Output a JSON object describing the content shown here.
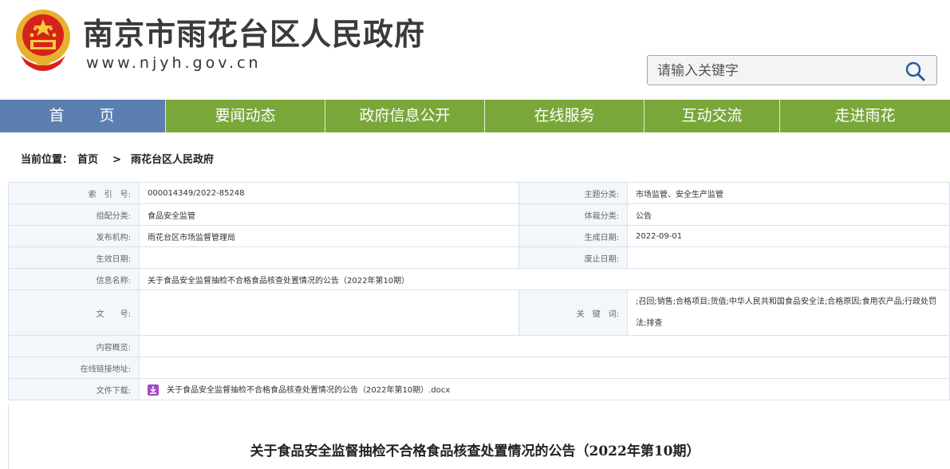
{
  "header": {
    "site_title": "南京市雨花台区人民政府",
    "site_url": "www.njyh.gov.cn",
    "search_placeholder": "请输入关键字"
  },
  "nav": {
    "items": [
      "首　　页",
      "要闻动态",
      "政府信息公开",
      "在线服务",
      "互动交流",
      "走进雨花"
    ]
  },
  "breadcrumb": {
    "prefix": "当前位置：",
    "home": "首页",
    "separator": ">",
    "current": "雨花台区人民政府"
  },
  "info": {
    "index_label": "索　引　号:",
    "index_value": "000014349/2022-85248",
    "topic_label": "主题分类:",
    "topic_value": "市场监管、安全生产监管",
    "org_label": "组配分类:",
    "org_value": "食品安全监管",
    "genre_label": "体裁分类:",
    "genre_value": "公告",
    "publisher_label": "发布机构:",
    "publisher_value": "雨花台区市场监督管理局",
    "created_label": "生成日期:",
    "created_value": "2022-09-01",
    "effective_label": "生效日期:",
    "effective_value": "",
    "expiry_label": "废止日期:",
    "expiry_value": "",
    "name_label": "信息名称:",
    "name_value": "关于食品安全监督抽检不合格食品核查处置情况的公告（2022年第10期）",
    "doc_label": "文　　号:",
    "doc_value": "",
    "keywords_label": "关　键　词:",
    "keywords_value": ";召回;销售;合格项目;货值;中华人民共和国食品安全法;合格原因;食用农产品;行政处罚法;排查",
    "summary_label": "内容概览:",
    "summary_value": "",
    "link_label": "在线链接地址:",
    "link_value": "",
    "download_label": "文件下载:",
    "download_value": "关于食品安全监督抽检不合格食品核查处置情况的公告（2022年第10期）.docx"
  },
  "article": {
    "title": "关于食品安全监督抽检不合格食品核查处置情况的公告（2022年第10期）"
  },
  "colors": {
    "nav_home": "#5a7fb0",
    "nav_green": "#7aa73a"
  }
}
